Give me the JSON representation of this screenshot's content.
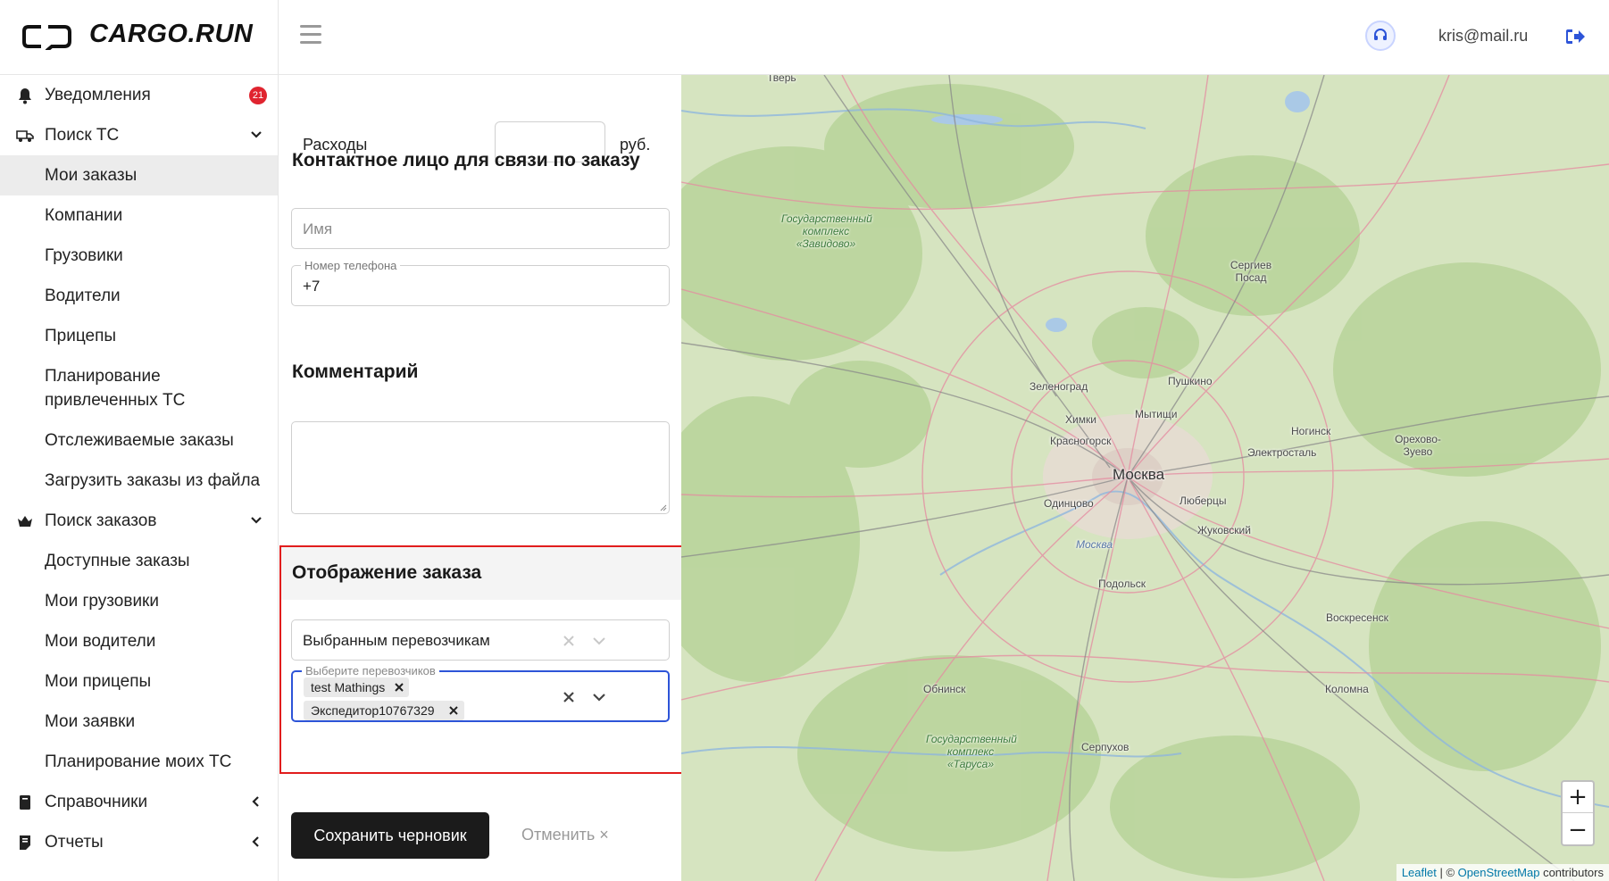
{
  "header": {
    "logo_text": "CARGO.RUN",
    "user_email": "kris@mail.ru",
    "icons": [
      "menu-icon",
      "support-icon",
      "logout-icon"
    ]
  },
  "sidebar": {
    "notifications": {
      "label": "Уведомления",
      "count": "21"
    },
    "search_vehicles": {
      "label": "Поиск ТС",
      "items": [
        "Мои заказы",
        "Компании",
        "Грузовики",
        "Водители",
        "Прицепы",
        "Планирование привлеченных ТС",
        "Отслеживаемые заказы",
        "Загрузить заказы из файла"
      ]
    },
    "search_orders": {
      "label": "Поиск заказов",
      "items": [
        "Доступные заказы",
        "Мои грузовики",
        "Мои водители",
        "Мои прицепы",
        "Мои заявки",
        "Планирование моих ТС"
      ]
    },
    "references": {
      "label": "Справочники"
    },
    "reports": {
      "label": "Отчеты"
    }
  },
  "form": {
    "expenses": {
      "label": "Расходы",
      "unit": "руб."
    },
    "contact": {
      "title": "Контактное лицо для связи по заказу",
      "name_placeholder": "Имя",
      "phone_label": "Номер телефона",
      "phone_value": "+7"
    },
    "comment": {
      "title": "Комментарий"
    },
    "display": {
      "title": "Отображение заказа",
      "mode_value": "Выбранным перевозчикам",
      "carriers_label": "Выберите перевозчиков",
      "carriers": [
        "test Mathings",
        "Экспедитор10767329"
      ]
    },
    "save_label": "Сохранить черновик",
    "cancel_label": "Отменить ×"
  },
  "map": {
    "labels": {
      "tver": "Тверь",
      "zavidovo": "Государственный комплекс «Завидово»",
      "sergiev": "Сергиев Посад",
      "zelenograd": "Зеленоград",
      "pushkino": "Пушкино",
      "khimki": "Химки",
      "mytishchi": "Мытищи",
      "krasnogorsk": "Красногорск",
      "noginsk": "Ногинск",
      "orekhovo": "Орехово-Зуево",
      "elektrostal": "Электросталь",
      "moscow": "Москва",
      "odintsovo": "Одинцово",
      "lyubertsy": "Люберцы",
      "zhukovsky": "Жуковский",
      "moskva_river": "Москва",
      "podolsk": "Подольск",
      "voskresensk": "Воскресенск",
      "obninsk": "Обнинск",
      "tarusa": "Государственный комплекс «Таруса»",
      "kolomna": "Коломна",
      "serpukhov": "Серпухов"
    },
    "zoom_in": "+",
    "zoom_out": "−",
    "attribution": {
      "leaflet": "Leaflet",
      "sep": " | © ",
      "osm": "OpenStreetMap",
      "contrib": " contributors"
    }
  }
}
